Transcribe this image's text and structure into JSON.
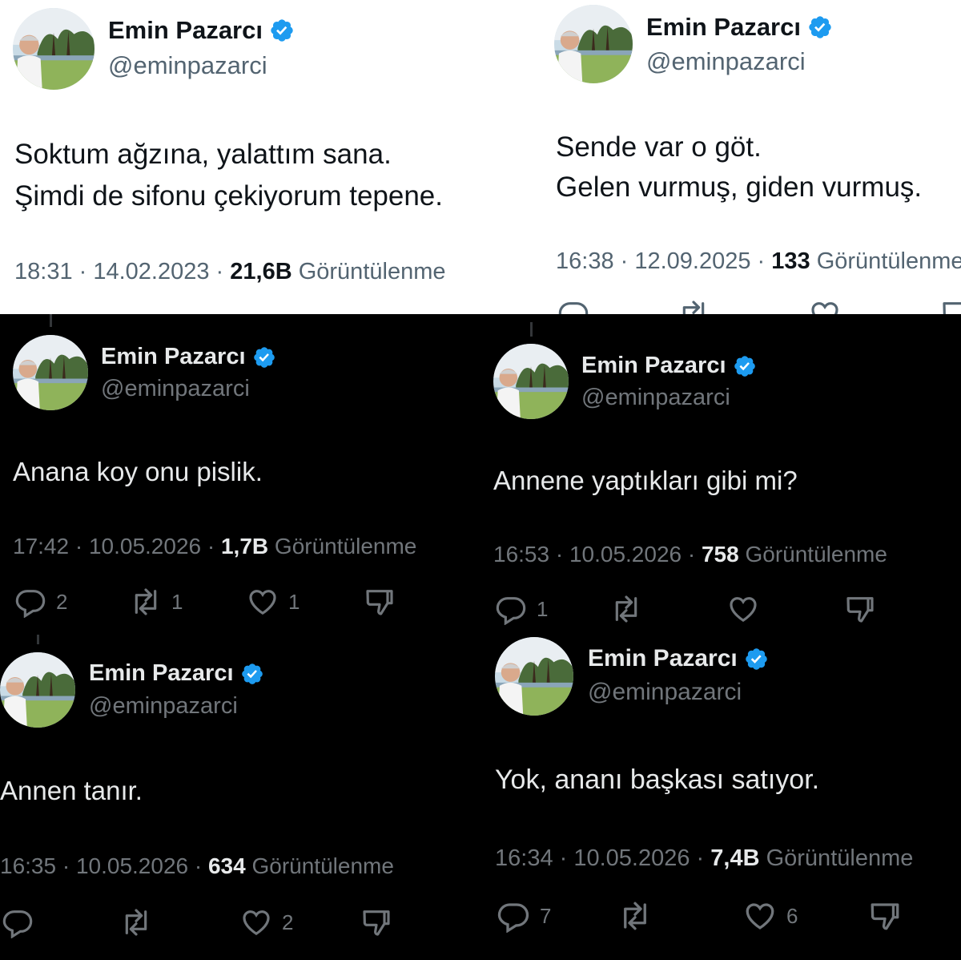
{
  "colors": {
    "verified": "#1d9bf0",
    "dark_bg": "#000000",
    "light_bg": "#ffffff",
    "muted": "#71767b"
  },
  "tweets": [
    {
      "name": "Emin Pazarcı",
      "handle": "@eminpazarci",
      "text": "Soktum ağzına, yalattım sana.\nŞimdi de sifonu çekiyorum tepene.",
      "time": "18:31 · 14.02.2023 · ",
      "views": "21,6B",
      "views_label": " Görüntülenme"
    },
    {
      "name": "Emin Pazarcı",
      "handle": "@eminpazarci",
      "text": "Sende var o göt.\nGelen vurmuş, giden vurmuş.",
      "time": "16:38 · 12.09.2025 · ",
      "views": "133",
      "views_label": " Görüntülenme"
    },
    {
      "name": "Emin Pazarcı",
      "handle": "@eminpazarci",
      "text": "Anana koy onu pislik.",
      "time": "17:42 · 10.05.2026 · ",
      "views": "1,7B",
      "views_label": " Görüntülenme",
      "replies": "2",
      "reposts": "1",
      "likes": "1"
    },
    {
      "name": "Emin Pazarcı",
      "handle": "@eminpazarci",
      "text": "Annene yaptıkları gibi mi?",
      "time": "16:53 · 10.05.2026 · ",
      "views": "758",
      "views_label": " Görüntülenme",
      "replies": "1",
      "reposts": "",
      "likes": ""
    },
    {
      "name": "Emin Pazarcı",
      "handle": "@eminpazarci",
      "text": "Annen tanır.",
      "time": "16:35 · 10.05.2026 · ",
      "views": "634",
      "views_label": " Görüntülenme",
      "replies": "",
      "reposts": "",
      "likes": "2"
    },
    {
      "name": "Emin Pazarcı",
      "handle": "@eminpazarci",
      "text": "Yok, ananı başkası satıyor.",
      "time": "16:34 · 10.05.2026 · ",
      "views": "7,4B",
      "views_label": " Görüntülenme",
      "replies": "7",
      "reposts": "",
      "likes": "6"
    }
  ],
  "icons": {
    "avatar": "avatar-photo",
    "verified": "verified-badge-icon",
    "reply": "reply-icon",
    "repost": "repost-icon",
    "like": "heart-icon",
    "dislike": "dislike-icon"
  }
}
